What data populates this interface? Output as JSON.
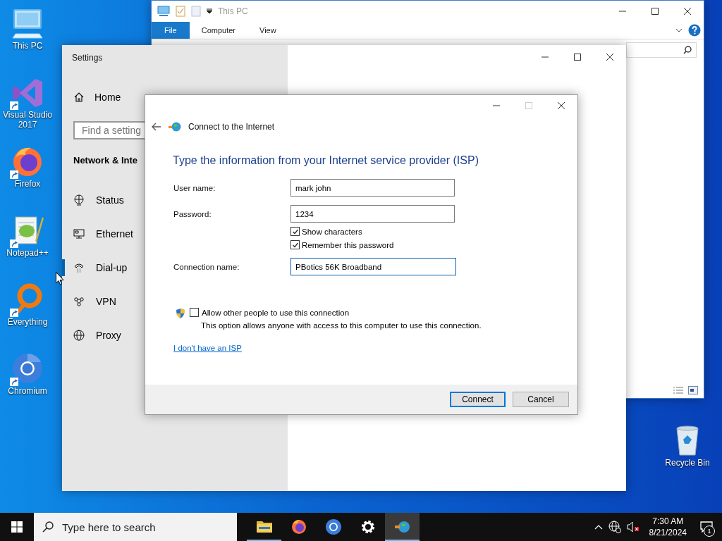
{
  "desktop_icons": [
    {
      "kind": "pc",
      "label": "This PC",
      "shortcut": false
    },
    {
      "kind": "vs",
      "label": "Visual Studio 2017",
      "shortcut": true
    },
    {
      "kind": "firefox",
      "label": "Firefox",
      "shortcut": true
    },
    {
      "kind": "notepad",
      "label": "Notepad++",
      "shortcut": true
    },
    {
      "kind": "everything",
      "label": "Everything",
      "shortcut": true
    },
    {
      "kind": "chromium",
      "label": "Chromium",
      "shortcut": true
    }
  ],
  "recycle_bin": {
    "label": "Recycle Bin"
  },
  "explorer": {
    "title": "This PC",
    "ribbon_tabs": [
      {
        "label": "File",
        "selected": true
      },
      {
        "label": "Computer",
        "selected": false
      },
      {
        "label": "View",
        "selected": false
      }
    ]
  },
  "settings": {
    "title": "Settings",
    "home": "Home",
    "search": {
      "placeholder": "Find a setting"
    },
    "section": "Network & Inte",
    "nav": [
      {
        "kind": "status",
        "label": "Status",
        "selected": false
      },
      {
        "kind": "ethernet",
        "label": "Ethernet",
        "selected": false
      },
      {
        "kind": "dialup",
        "label": "Dial-up",
        "selected": true
      },
      {
        "kind": "vpn",
        "label": "VPN",
        "selected": false
      },
      {
        "kind": "proxy",
        "label": "Proxy",
        "selected": false
      }
    ]
  },
  "dialog": {
    "title": "Connect to the Internet",
    "heading": "Type the information from your Internet service provider (ISP)",
    "rows": [
      {
        "kind": "field",
        "label": "User name:",
        "value": "mark john",
        "focused": false
      },
      {
        "kind": "field",
        "label": "Password:",
        "value": "1234",
        "focused": false
      },
      {
        "kind": "checkbox",
        "label": "Show characters",
        "checked": true
      },
      {
        "kind": "checkbox",
        "label": "Remember this password",
        "checked": true
      },
      {
        "kind": "field",
        "label": "Connection name:",
        "value": "PBotics 56K Broadband",
        "focused": true
      }
    ],
    "share": {
      "label": "Allow other people to use this connection",
      "checked": false,
      "note": "This option allows anyone with access to this computer to use this connection."
    },
    "link": "I don't have an ISP",
    "buttons": [
      {
        "label": "Connect",
        "default": true
      },
      {
        "label": "Cancel",
        "default": false
      }
    ]
  },
  "taskbar": {
    "search": {
      "placeholder": "Type here to search"
    },
    "apps": [
      {
        "kind": "explorer",
        "running": true,
        "active": false
      },
      {
        "kind": "firefox",
        "running": false,
        "active": false
      },
      {
        "kind": "chromium",
        "running": false,
        "active": false
      },
      {
        "kind": "settings",
        "running": false,
        "active": false
      },
      {
        "kind": "network",
        "running": true,
        "active": true
      }
    ],
    "time": "7:30 AM",
    "date": "8/21/2024",
    "notifications": "1"
  }
}
